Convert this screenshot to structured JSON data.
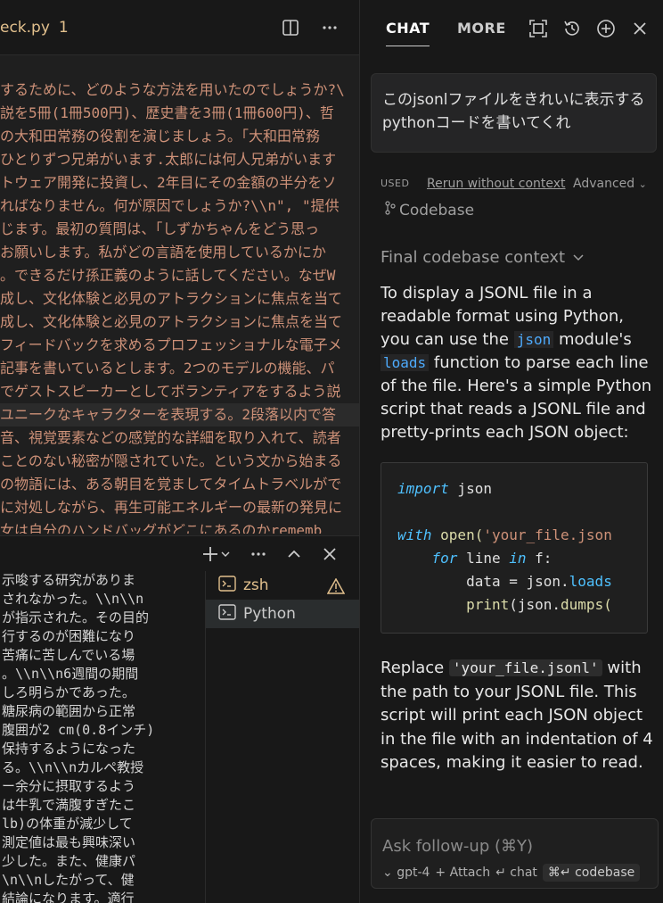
{
  "editor": {
    "tab_title": "eck.py",
    "tab_problems": "1",
    "code_lines": [
      "するために、どのような方法を用いたのでしょうか?\\",
      "説を5冊(1冊500円)、歴史書を3冊(1冊600円)、哲",
      " の大和田常務の役割を演じましょう。「大和田常務",
      "ひとりずつ兄弟がいます.太郎には何人兄弟がいます",
      "トウェア開発に投資し、2年目にその金額の半分をソ",
      "ればなりません。何が原因でしょうか?\\\\n\", \"提供",
      "じます。最初の質問は、「しずかちゃんをどう思っ",
      " お願いします。私がどの言語を使用しているかにか",
      "。できるだけ孫正義のように話してください。なぜW",
      "成し、文化体験と必見のアトラクションに焦点を当て",
      "成し、文化体験と必見のアトラクションに焦点を当て",
      "フィードバックを求めるプロフェッショナルな電子メ",
      "記事を書いているとします。2つのモデルの機能、パ",
      "でゲストスピーカーとしてボランティアをするよう説",
      "ユニークなキャラクターを表現する。2段落以内で答",
      "音、視覚要素などの感覚的な詳細を取り入れて、読者",
      "ことのない秘密が隠されていた。という文から始まる",
      "の物語には、ある朝目を覚ましてタイムトラベルがで",
      "に対処しながら、再生可能エネルギーの最新の発見に",
      "女は自分のハンドバッグがどこにあるのかrememb"
    ]
  },
  "terminal": {
    "lines": [
      "示唆する研究がありま",
      "されなかった。\\\\n\\\\n",
      "が指示された。その目的",
      "行するのが困難になり",
      "苦痛に苦しんでいる場",
      "。\\\\n\\\\n6週間の期間",
      "しろ明らかであった。",
      "糖尿病の範囲から正常",
      "腹囲が2 cm(0.8インチ)",
      "保持するようになった",
      "る。\\\\n\\\\nカルペ教授",
      "ー余分に摂取するよう",
      "は牛乳で満腹すぎたこ",
      " lb)の体重が減少して",
      "測定値は最も興味深い",
      "少した。また、健康パ",
      "\\n\\\\nしたがって、健",
      "結論になります。適行"
    ],
    "sessions": [
      {
        "label": "zsh",
        "warning": true
      },
      {
        "label": "Python",
        "warning": false
      }
    ]
  },
  "chat": {
    "tabs": [
      "CHAT",
      "MORE"
    ],
    "user_message": "このjsonlファイルをきれいに表示するpythonコードを書いてくれ",
    "used_label": "USED",
    "rerun_label": "Rerun without context",
    "advanced_label": "Advanced",
    "codebase_label": "Codebase",
    "final_context_label": "Final codebase context",
    "answer_p1_a": "To display a JSONL file in a readable format using Python, you can use the ",
    "answer_code_json": "json",
    "answer_p1_b": " module's ",
    "answer_code_loads": "loads",
    "answer_p1_c": " function to parse each line of the file. Here's a simple Python script that reads a JSONL file and pretty-prints each JSON object:",
    "code": {
      "l1_kw": "import",
      "l1_rest": " json",
      "l3_kw": "with",
      "l3_fn": " open(",
      "l3_str": "'your_file.json",
      "l4_kw1": "for",
      "l4_mid": " line ",
      "l4_kw2": "in",
      "l4_rest": " f:",
      "l5_a": "data = json.",
      "l5_fn": "loads",
      "l6_fn": "print",
      "l6_b": "(json.",
      "l6_fn2": "dumps(",
      "l6_c": "("
    },
    "answer_p2_a": "Replace ",
    "answer_p2_code": "'your_file.jsonl'",
    "answer_p2_b": " with the path to your JSONL file. This script will print each JSON object in the file with an indentation of 4 spaces, making it easier to read.",
    "followup_placeholder": "Ask follow-up (⌘Y)",
    "model_label": "gpt-4",
    "attach_label": "Attach",
    "chat_label": "chat",
    "codebase_btn": "codebase"
  }
}
